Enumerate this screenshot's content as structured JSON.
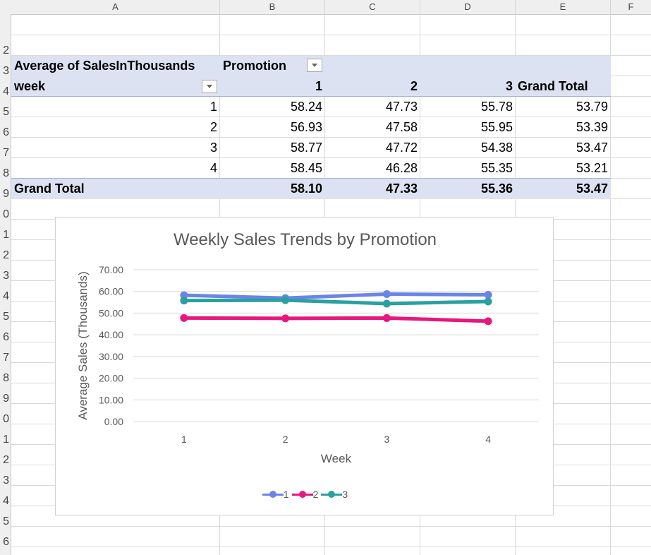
{
  "columns": [
    "A",
    "B",
    "C",
    "D",
    "E",
    "F"
  ],
  "row_numbers": [
    "2",
    "3",
    "4",
    "5",
    "6",
    "7",
    "8",
    "9",
    "0",
    "1",
    "2",
    "3",
    "4",
    "5",
    "6",
    "7",
    "8",
    "9",
    "0",
    "1",
    "2",
    "3",
    "4",
    "5",
    "6"
  ],
  "pivot": {
    "values_label": "Average of SalesInThousands",
    "column_field": "Promotion",
    "row_field": "week",
    "column_keys": [
      "1",
      "2",
      "3"
    ],
    "grand_total_label": "Grand Total",
    "rows": [
      {
        "label": "1",
        "values": [
          "58.24",
          "47.73",
          "55.78",
          "53.79"
        ]
      },
      {
        "label": "2",
        "values": [
          "56.93",
          "47.58",
          "55.95",
          "53.39"
        ]
      },
      {
        "label": "3",
        "values": [
          "58.77",
          "47.72",
          "54.38",
          "53.47"
        ]
      },
      {
        "label": "4",
        "values": [
          "58.45",
          "46.28",
          "55.35",
          "53.21"
        ]
      }
    ],
    "grand_total_row": {
      "label": "Grand Total",
      "values": [
        "58.10",
        "47.33",
        "55.36",
        "53.47"
      ]
    }
  },
  "chart_data": {
    "type": "line",
    "title": "Weekly Sales Trends by Promotion",
    "xlabel": "Week",
    "ylabel": "Average Sales (Thousands)",
    "categories": [
      "1",
      "2",
      "3",
      "4"
    ],
    "ylim": [
      0,
      70
    ],
    "yticks": [
      "0.00",
      "10.00",
      "20.00",
      "30.00",
      "40.00",
      "50.00",
      "60.00",
      "70.00"
    ],
    "grid": true,
    "legend_position": "bottom",
    "series": [
      {
        "name": "1",
        "color": "#6b85e6",
        "values": [
          58.24,
          56.93,
          58.77,
          58.45
        ]
      },
      {
        "name": "2",
        "color": "#e6177f",
        "values": [
          47.73,
          47.58,
          47.72,
          46.28
        ]
      },
      {
        "name": "3",
        "color": "#2aa0a0",
        "values": [
          55.78,
          55.95,
          54.38,
          55.35
        ]
      }
    ]
  }
}
